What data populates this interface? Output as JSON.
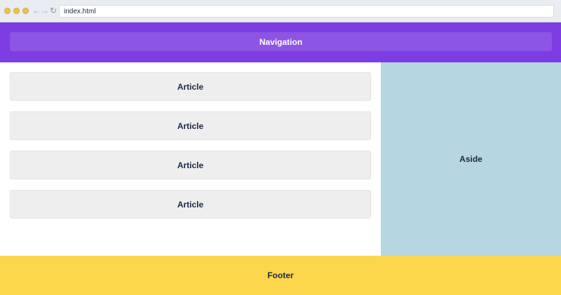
{
  "browser": {
    "url": "index.html",
    "back_icon": "arrow-left-icon",
    "forward_icon": "arrow-right-icon",
    "reload_icon": "reload-icon"
  },
  "page": {
    "navigation": "Navigation",
    "articles": [
      "Article",
      "Article",
      "Article",
      "Article"
    ],
    "aside": "Aside",
    "footer": "Footer"
  },
  "colors": {
    "nav_band": "#7e3de2",
    "nav_box": "#8c55e3",
    "article_bg": "#eeeeee",
    "aside_bg": "#b6d6e1",
    "footer_bg": "#fcd64b",
    "text_dark": "#1d2846"
  }
}
